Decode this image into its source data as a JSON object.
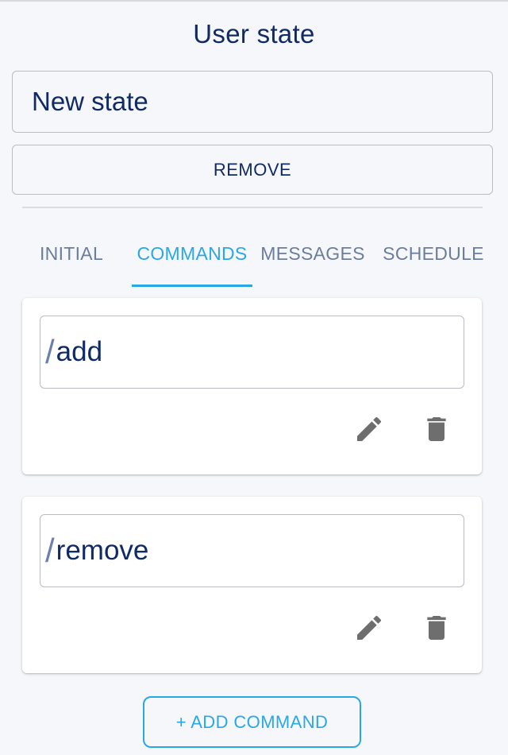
{
  "header": {
    "title": "User state"
  },
  "state": {
    "name_value": "New state",
    "remove_label": "REMOVE"
  },
  "tabs": [
    {
      "label": "INITIAL",
      "active": false
    },
    {
      "label": "COMMANDS",
      "active": true
    },
    {
      "label": "MESSAGES",
      "active": false
    },
    {
      "label": "SCHEDULE",
      "active": false
    }
  ],
  "commands": [
    {
      "prefix": "/",
      "value": "add",
      "edit_icon": "pencil-icon",
      "delete_icon": "trash-icon"
    },
    {
      "prefix": "/",
      "value": "remove",
      "edit_icon": "pencil-icon",
      "delete_icon": "trash-icon"
    }
  ],
  "footer": {
    "add_command_label": "+ ADD COMMAND"
  },
  "colors": {
    "accent": "#29a8e6",
    "text_primary": "#102a66",
    "tab_inactive": "#6b7d9c",
    "icon": "#6e6e6e"
  }
}
